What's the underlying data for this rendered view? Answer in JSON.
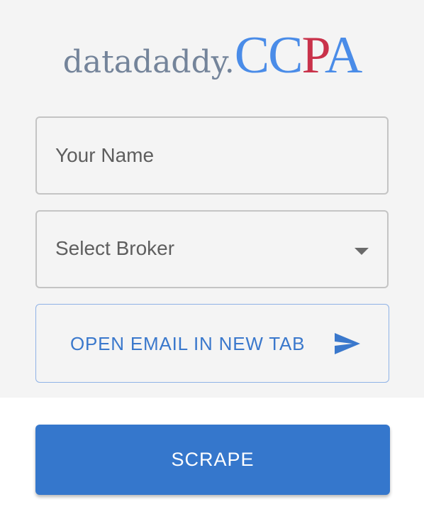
{
  "logo": {
    "prefix": "datadaddy.",
    "c1": "C",
    "c2": "C",
    "p": "P",
    "a": "A"
  },
  "name_field": {
    "placeholder": "Your Name",
    "value": ""
  },
  "broker_select": {
    "selected": "Select Broker"
  },
  "open_email_button": {
    "label": "OPEN EMAIL IN NEW TAB",
    "icon": "send-icon"
  },
  "scrape_button": {
    "label": "SCRAPE"
  },
  "colors": {
    "accent_blue": "#3577cc",
    "logo_blue": "#4a8ce8",
    "logo_red": "#c9324a",
    "logo_gray": "#74849a",
    "panel_bg": "#f4f4f4"
  }
}
